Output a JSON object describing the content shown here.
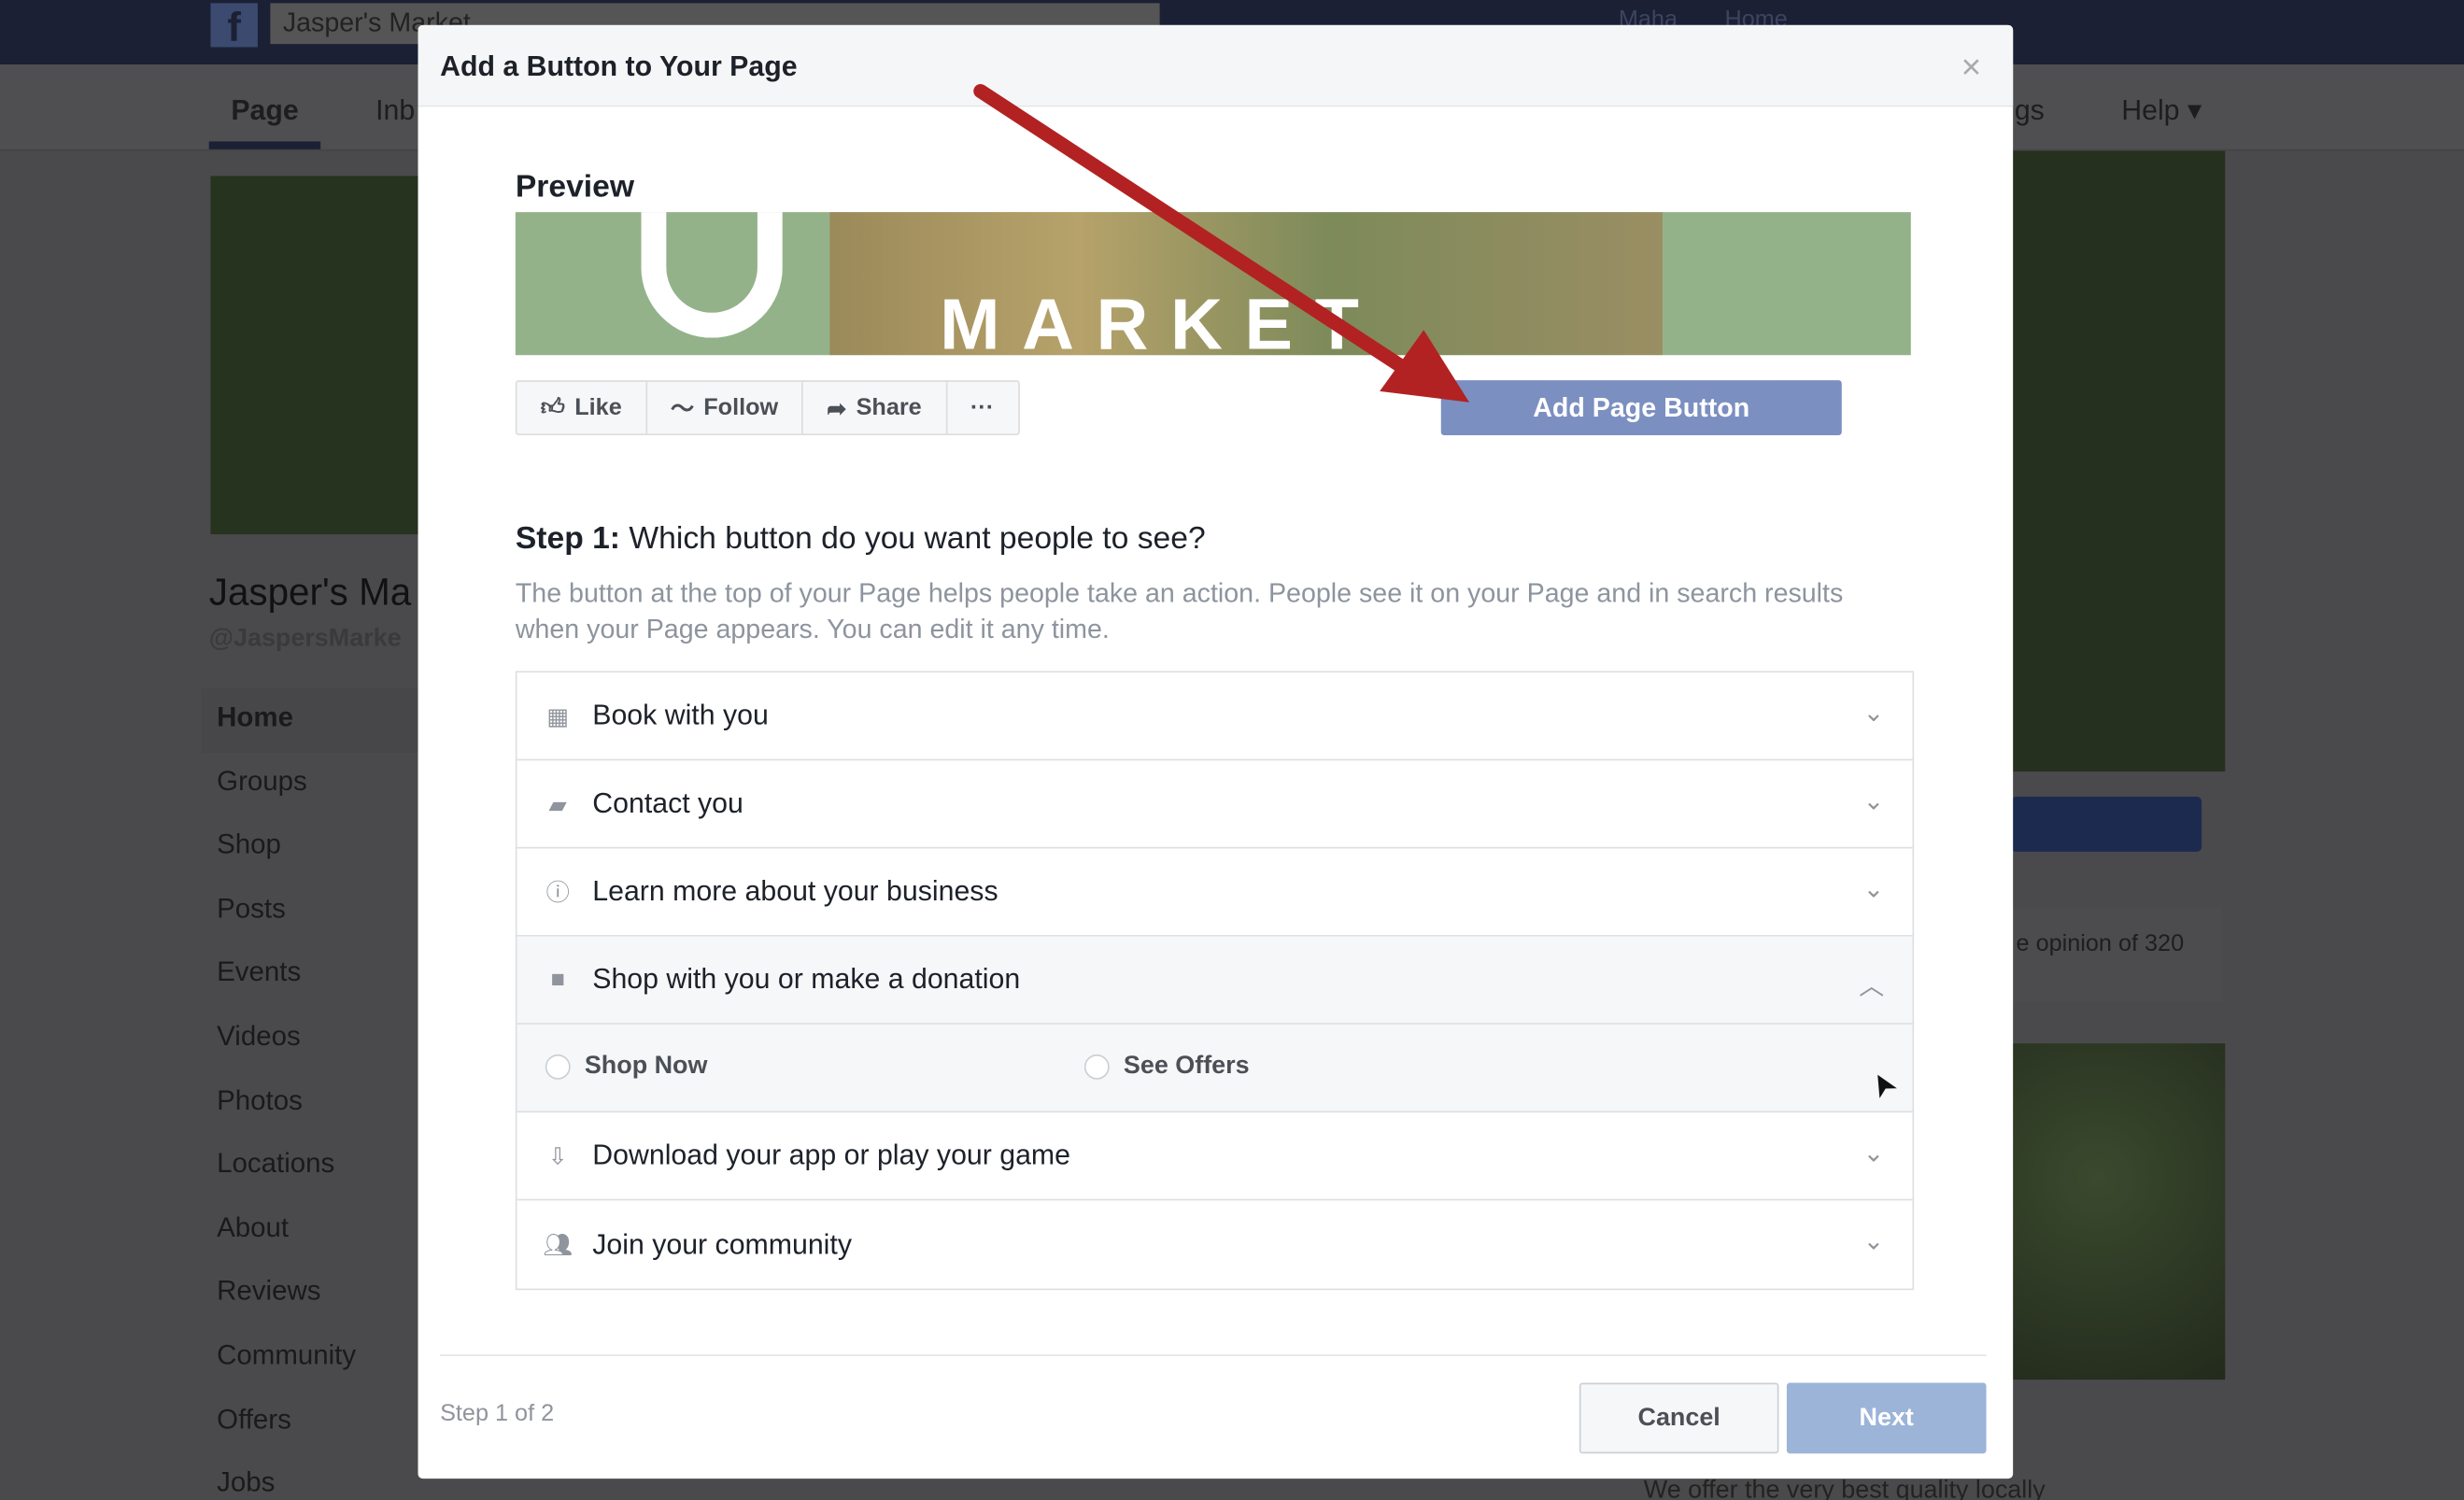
{
  "topbar": {
    "logo": "f",
    "search_value": "Jasper's Market",
    "user": "Maha",
    "home": "Home"
  },
  "subnav": {
    "tabs": [
      "Page",
      "Inb",
      "gs",
      "Help ▾"
    ]
  },
  "page": {
    "name": "Jasper's Ma",
    "handle": "@JaspersMarke",
    "right_text": "e opinion of 320",
    "bottom_text": "We offer the very best quality locally"
  },
  "sidebar": {
    "items": [
      "Home",
      "Groups",
      "Shop",
      "Posts",
      "Events",
      "Videos",
      "Photos",
      "Locations",
      "About",
      "Reviews",
      "Community",
      "Offers",
      "Jobs"
    ]
  },
  "modal": {
    "title": "Add a Button to Your Page",
    "close": "×",
    "preview_label": "Preview",
    "banner_text": "MARKET",
    "actions": [
      {
        "icon": "thumbs-up",
        "label": "Like"
      },
      {
        "icon": "rss",
        "label": "Follow"
      },
      {
        "icon": "share",
        "label": "Share"
      },
      {
        "icon": "more",
        "label": "···"
      }
    ],
    "add_button": "Add Page Button",
    "step_label": "Step 1:",
    "step_question": "Which button do you want people to see?",
    "description": "The button at the top of your Page helps people take an action. People see it on your Page and in search results when your Page appears. You can edit it any time.",
    "options": [
      {
        "icon": "calendar",
        "label": "Book with you",
        "expanded": false
      },
      {
        "icon": "chat",
        "label": "Contact you",
        "expanded": false
      },
      {
        "icon": "info",
        "label": "Learn more about your business",
        "expanded": false
      },
      {
        "icon": "bag",
        "label": "Shop with you or make a donation",
        "expanded": true
      },
      {
        "icon": "download",
        "label": "Download your app or play your game",
        "expanded": false
      },
      {
        "icon": "people",
        "label": "Join your community",
        "expanded": false
      }
    ],
    "sub_options": [
      "Shop Now",
      "See Offers"
    ],
    "step_count": "Step 1 of 2",
    "cancel": "Cancel",
    "next": "Next"
  },
  "colors": {
    "navbar": "#1b2035",
    "primary_button": "#7b8fc1",
    "next_disabled": "#9cb4d8",
    "annotation_arrow": "#b22222"
  }
}
